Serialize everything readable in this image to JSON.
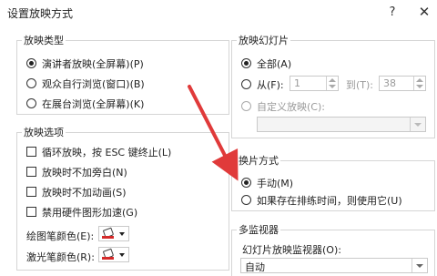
{
  "dialog": {
    "title": "设置放映方式",
    "help_glyph": "?",
    "close_glyph": "✕"
  },
  "show_type": {
    "title": "放映类型",
    "options": [
      {
        "label": "演讲者放映(全屏幕)(P)",
        "checked": true
      },
      {
        "label": "观众自行浏览(窗口)(B)",
        "checked": false
      },
      {
        "label": "在展台浏览(全屏幕)(K)",
        "checked": false
      }
    ]
  },
  "show_options": {
    "title": "放映选项",
    "checkboxes": [
      {
        "label": "循环放映，按 ESC 键终止(L)"
      },
      {
        "label": "放映时不加旁白(N)"
      },
      {
        "label": "放映时不加动画(S)"
      },
      {
        "label": "禁用硬件图形加速(G)"
      }
    ],
    "pen_color_label": "绘图笔颜色(E):",
    "laser_color_label": "激光笔颜色(R):"
  },
  "slides": {
    "title": "放映幻灯片",
    "all_label": "全部(A)",
    "from_label": "从(F):",
    "from_value": "1",
    "to_label": "到(T):",
    "to_value": "38",
    "custom_label": "自定义放映(C):",
    "custom_value": ""
  },
  "advance": {
    "title": "换片方式",
    "manual_label": "手动(M)",
    "timing_label": "如果存在排练时间，则使用它(U)"
  },
  "monitors": {
    "title": "多监视器",
    "monitor_label": "幻灯片放映监视器(O):",
    "monitor_value": "自动"
  },
  "colors": {
    "pen": "#d42a2a",
    "laser": "#d42a2a",
    "arrow": "#e03a3a"
  }
}
